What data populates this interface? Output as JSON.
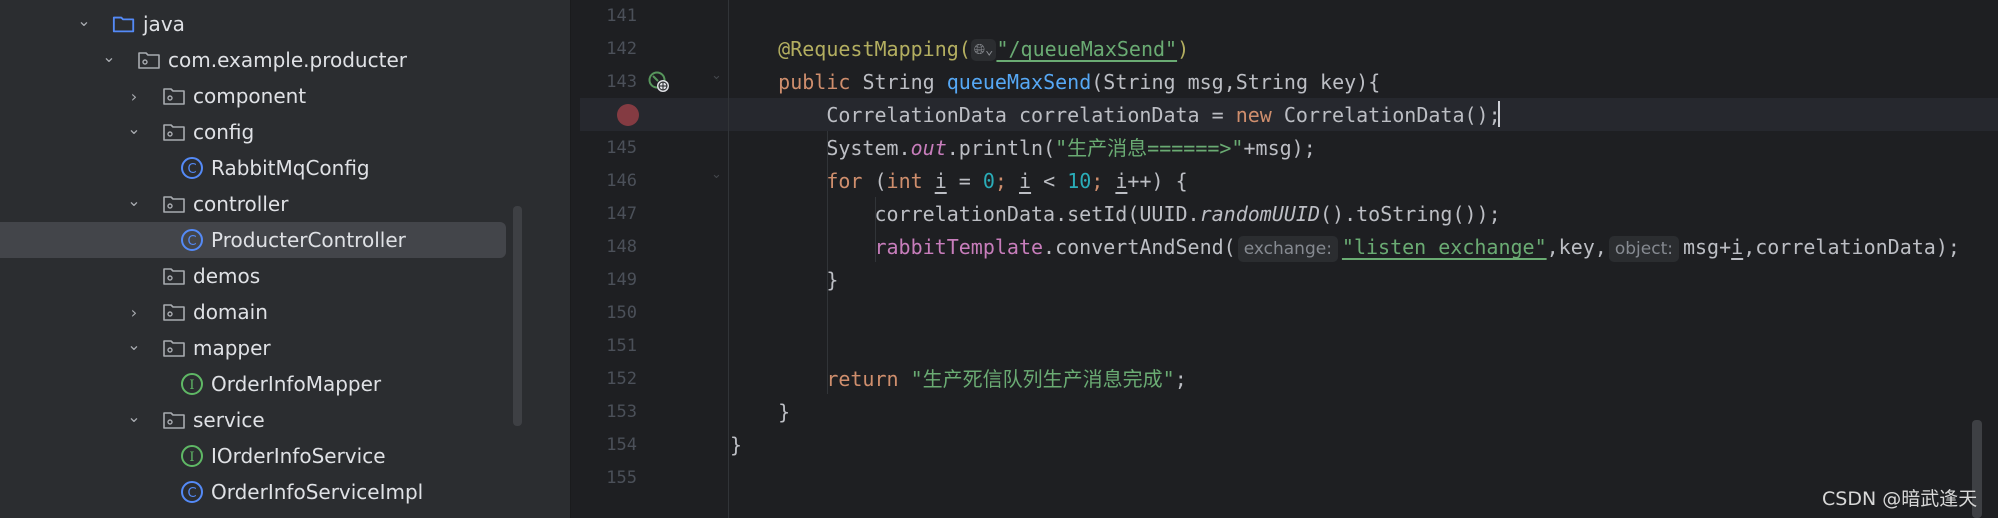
{
  "project_tree": {
    "items": [
      {
        "label": "java",
        "icon": "source-folder-icon",
        "expander": "expanded",
        "depth": 0
      },
      {
        "label": "com.example.producter",
        "icon": "package-icon",
        "expander": "expanded",
        "depth": 1
      },
      {
        "label": "component",
        "icon": "package-icon",
        "expander": "collapsed",
        "depth": 2
      },
      {
        "label": "config",
        "icon": "package-icon",
        "expander": "expanded",
        "depth": 2
      },
      {
        "label": "RabbitMqConfig",
        "icon": "class-icon",
        "expander": "none",
        "depth": 3
      },
      {
        "label": "controller",
        "icon": "package-icon",
        "expander": "expanded",
        "depth": 2
      },
      {
        "label": "ProducterController",
        "icon": "class-icon",
        "expander": "none",
        "depth": 3,
        "selected": true
      },
      {
        "label": "demos",
        "icon": "package-icon",
        "expander": "none",
        "depth": 2
      },
      {
        "label": "domain",
        "icon": "package-icon",
        "expander": "collapsed",
        "depth": 2
      },
      {
        "label": "mapper",
        "icon": "package-icon",
        "expander": "expanded",
        "depth": 2
      },
      {
        "label": "OrderInfoMapper",
        "icon": "interface-icon",
        "expander": "none",
        "depth": 3
      },
      {
        "label": "service",
        "icon": "package-icon",
        "expander": "expanded",
        "depth": 2
      },
      {
        "label": "IOrderInfoService",
        "icon": "interface-icon",
        "expander": "none",
        "depth": 3
      },
      {
        "label": "OrderInfoServiceImpl",
        "icon": "class-icon",
        "expander": "none",
        "depth": 3
      }
    ]
  },
  "editor": {
    "current_line": 144,
    "breakpoint_line": 144,
    "colors": {
      "keyword": "#cf8e6d",
      "annotation": "#b3ae60",
      "string": "#6aab73",
      "number": "#2aacb8",
      "method": "#56a8f5",
      "field": "#c77dbb",
      "text": "#bcbec4",
      "breakpoint": "#a4414a"
    },
    "lines": [
      {
        "n": "141",
        "indent": 0,
        "tokens": []
      },
      {
        "n": "142",
        "indent": 1,
        "tokens": [
          {
            "t": "@RequestMapping(",
            "k": "ann"
          },
          {
            "t": "🌐︎⌄",
            "k": "globe"
          },
          {
            "t": "\"/queueMaxSend\"",
            "k": "str ul"
          },
          {
            "t": ")",
            "k": "ann"
          }
        ]
      },
      {
        "n": "143",
        "indent": 1,
        "tokens": [
          {
            "t": "public ",
            "k": "kw"
          },
          {
            "t": "String ",
            "k": "pl"
          },
          {
            "t": "queueMaxSend",
            "k": "fn"
          },
          {
            "t": "(String msg,String key){",
            "k": "pl"
          }
        ]
      },
      {
        "n": "",
        "indent": 2,
        "tokens": [
          {
            "t": "CorrelationData correlationData = ",
            "k": "pl"
          },
          {
            "t": "new ",
            "k": "kw"
          },
          {
            "t": "CorrelationData();",
            "k": "pl"
          }
        ]
      },
      {
        "n": "145",
        "indent": 2,
        "tokens": [
          {
            "t": "System.",
            "k": "pl"
          },
          {
            "t": "out",
            "k": "fld ital"
          },
          {
            "t": ".println(",
            "k": "pl"
          },
          {
            "t": "\"生产消息======>\"",
            "k": "str"
          },
          {
            "t": "+msg);",
            "k": "pl"
          }
        ]
      },
      {
        "n": "146",
        "indent": 2,
        "tokens": [
          {
            "t": "for ",
            "k": "kw"
          },
          {
            "t": "(",
            "k": "pl"
          },
          {
            "t": "int ",
            "k": "kw"
          },
          {
            "t": "i",
            "k": "pl ul"
          },
          {
            "t": " = ",
            "k": "pl"
          },
          {
            "t": "0",
            "k": "num"
          },
          {
            "t": "; ",
            "k": "kw"
          },
          {
            "t": "i",
            "k": "pl ul"
          },
          {
            "t": " < ",
            "k": "pl"
          },
          {
            "t": "10",
            "k": "num"
          },
          {
            "t": "; ",
            "k": "kw"
          },
          {
            "t": "i",
            "k": "pl ul"
          },
          {
            "t": "++) {",
            "k": "pl"
          }
        ]
      },
      {
        "n": "147",
        "indent": 3,
        "tokens": [
          {
            "t": "correlationData.setId(UUID.",
            "k": "pl"
          },
          {
            "t": "randomUUID",
            "k": "pl ital"
          },
          {
            "t": "().toString());",
            "k": "pl"
          }
        ]
      },
      {
        "n": "148",
        "indent": 3,
        "tokens": [
          {
            "t": "rabbitTemplate",
            "k": "fld"
          },
          {
            "t": ".convertAndSend(",
            "k": "pl"
          },
          {
            "t": "exchange:",
            "k": "hint"
          },
          {
            "t": "\"listen_exchange\"",
            "k": "str ul"
          },
          {
            "t": ",key,",
            "k": "pl"
          },
          {
            "t": "object:",
            "k": "hint"
          },
          {
            "t": "msg+",
            "k": "pl"
          },
          {
            "t": "i",
            "k": "pl ul"
          },
          {
            "t": ",correlationData);",
            "k": "pl"
          }
        ]
      },
      {
        "n": "149",
        "indent": 2,
        "tokens": [
          {
            "t": "}",
            "k": "pl"
          }
        ]
      },
      {
        "n": "150",
        "indent": 0,
        "tokens": []
      },
      {
        "n": "151",
        "indent": 0,
        "tokens": []
      },
      {
        "n": "152",
        "indent": 2,
        "tokens": [
          {
            "t": "return ",
            "k": "kw"
          },
          {
            "t": "\"生产死信队列生产消息完成\"",
            "k": "str"
          },
          {
            "t": ";",
            "k": "pl"
          }
        ]
      },
      {
        "n": "153",
        "indent": 1,
        "tokens": [
          {
            "t": "}",
            "k": "pl"
          }
        ]
      },
      {
        "n": "154",
        "indent": 0,
        "tokens": [
          {
            "t": "}",
            "k": "pl"
          }
        ]
      },
      {
        "n": "155",
        "indent": 0,
        "tokens": []
      }
    ]
  },
  "watermark": "CSDN @暗武逢天"
}
